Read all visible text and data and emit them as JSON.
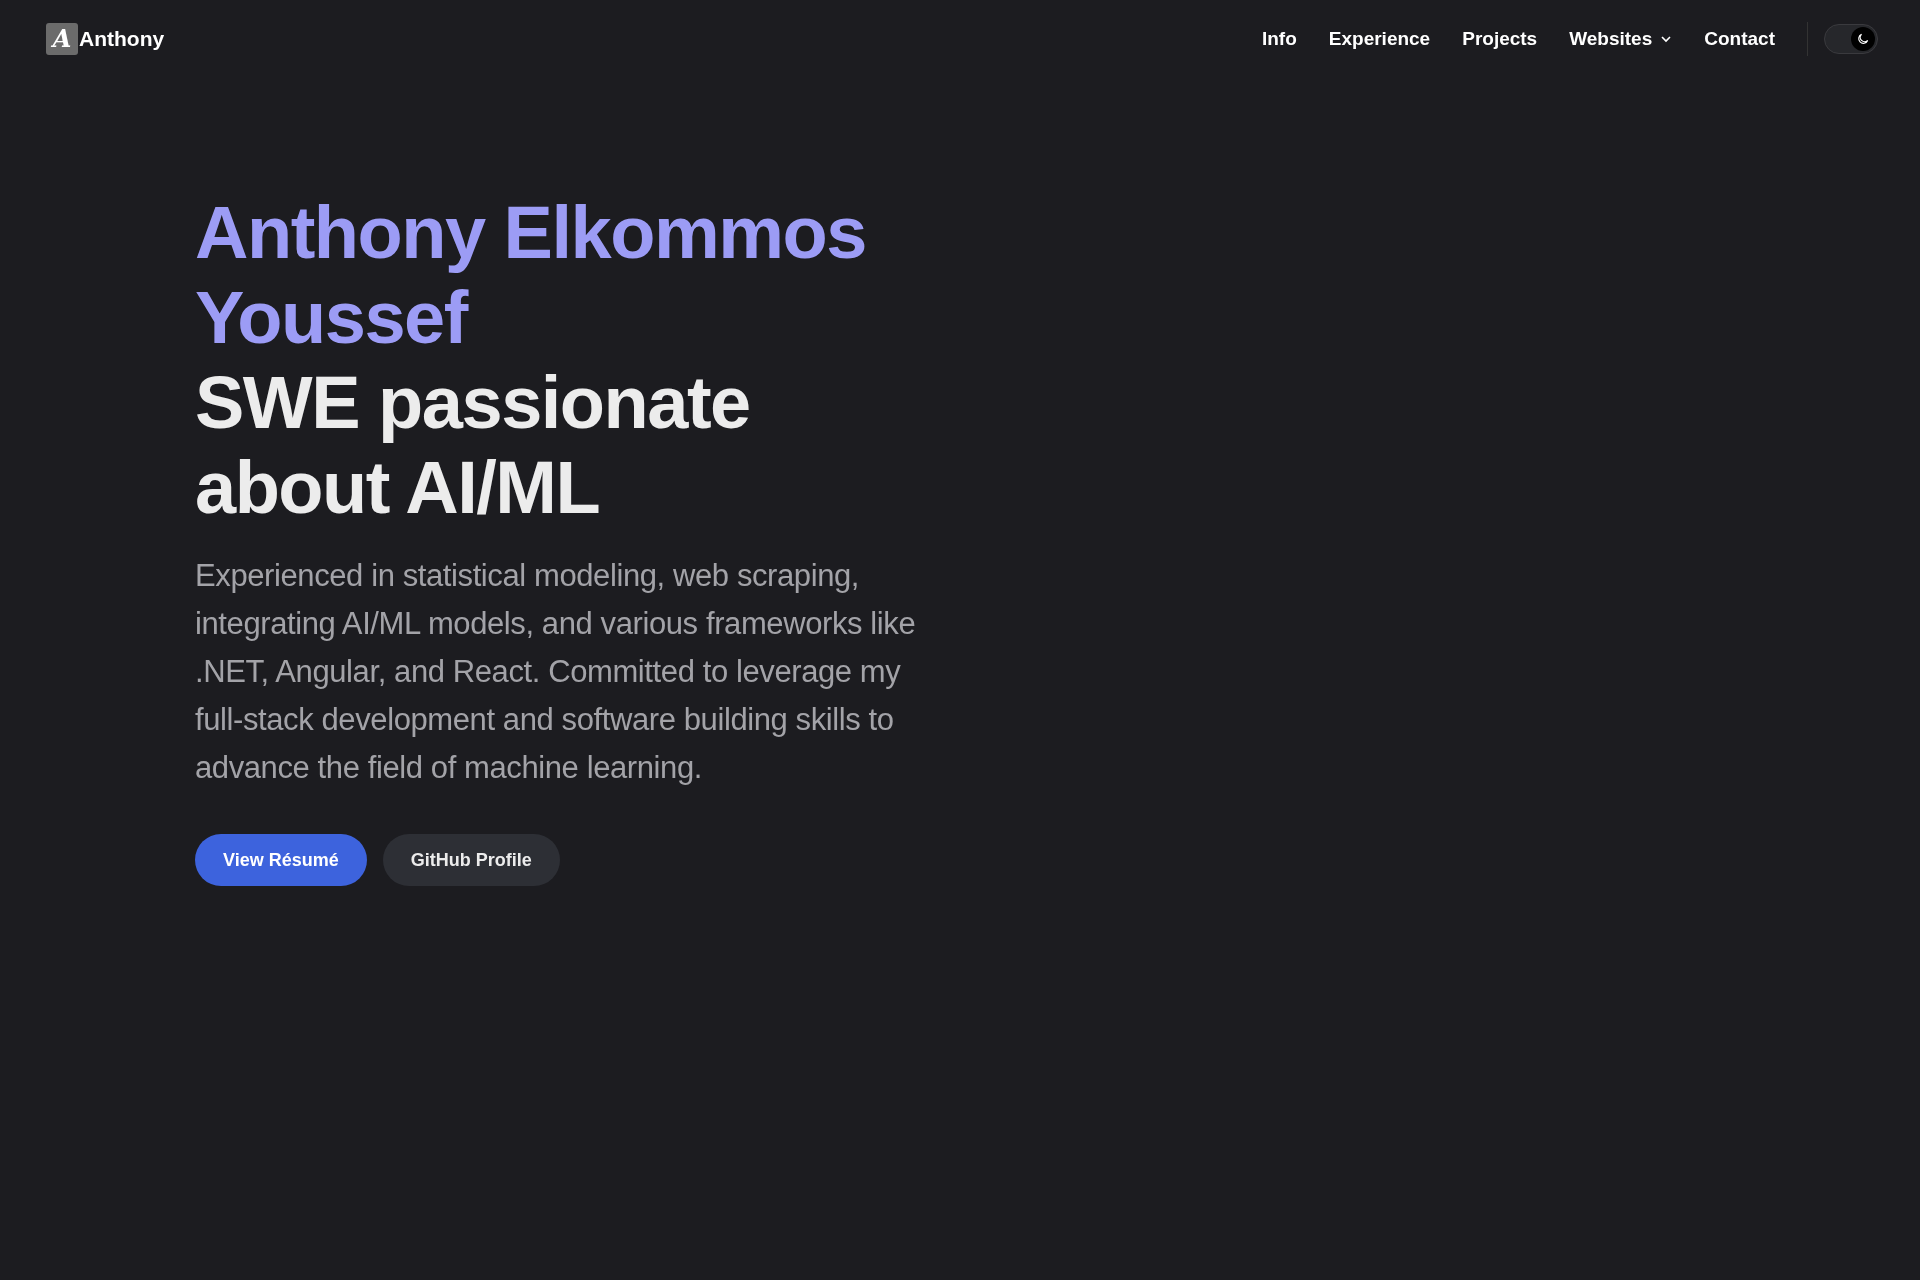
{
  "header": {
    "logo_letter": "A",
    "brand": "Anthony",
    "nav": [
      {
        "label": "Info",
        "kind": "link"
      },
      {
        "label": "Experience",
        "kind": "link"
      },
      {
        "label": "Projects",
        "kind": "link"
      },
      {
        "label": "Websites",
        "kind": "dropdown"
      },
      {
        "label": "Contact",
        "kind": "link"
      }
    ],
    "dark_mode": {
      "on": true
    }
  },
  "hero": {
    "name": "Anthony Elkommos Youssef",
    "headline": "SWE passionate about AI/ML",
    "description": "Experienced in statistical modeling, web scraping, integrating AI/ML models, and various frameworks like .NET, Angular, and React. Committed to leverage my full-stack development and software building skills to advance the field of machine learning.",
    "buttons": [
      {
        "label": "View Résumé",
        "kind": "primary"
      },
      {
        "label": "GitHub Profile",
        "kind": "secondary"
      }
    ]
  }
}
